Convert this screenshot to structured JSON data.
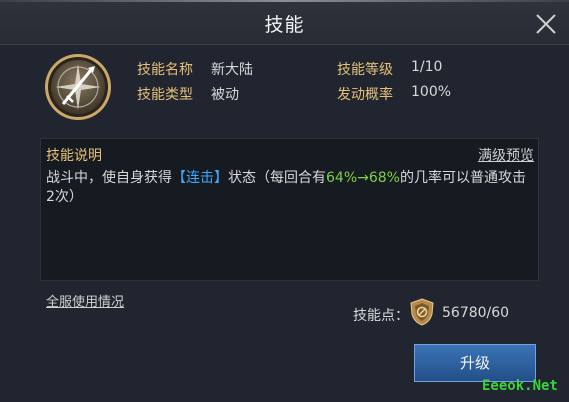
{
  "dialog": {
    "title": "技能"
  },
  "skill": {
    "name_label": "技能名称",
    "name_value": "新大陆",
    "type_label": "技能类型",
    "type_value": "被动",
    "level_label": "技能等级",
    "level_value": "1/10",
    "rate_label": "发动概率",
    "rate_value": "100%",
    "icon": "compass-sword-icon"
  },
  "description": {
    "title": "技能说明",
    "preview_link": "满级预览",
    "text_part1": "战斗中，使自身获得",
    "keyword": "【连击】",
    "text_part2": "状态（每回合有",
    "rate_range": "64%→68%",
    "text_part3": "的几率可以普通攻击2次）"
  },
  "usage_link": "全服使用情况",
  "points": {
    "label": "技能点：",
    "value": "56780/60"
  },
  "upgrade_button": "升级",
  "watermark": "Eeeok.Net",
  "colors": {
    "label_gold": "#e6c07a",
    "keyword_blue": "#3fa9ff",
    "rate_green": "#7fd04a",
    "button_blue": "#2e64a6"
  }
}
